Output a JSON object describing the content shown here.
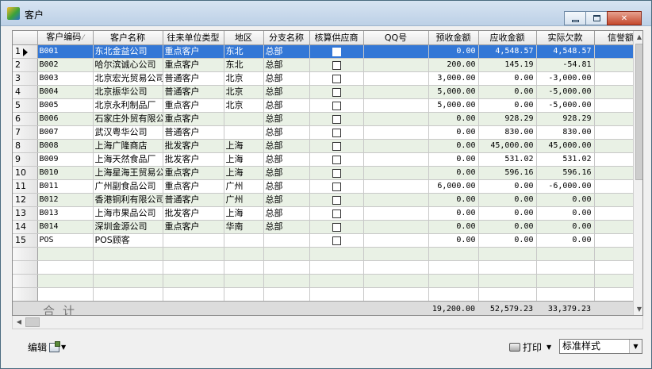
{
  "window": {
    "title": "客户"
  },
  "grid": {
    "columns": [
      {
        "key": "code",
        "label": "客户编码",
        "width": 70,
        "sort": "⁄"
      },
      {
        "key": "name",
        "label": "客户名称",
        "width": 88
      },
      {
        "key": "type",
        "label": "往来单位类型",
        "width": 77
      },
      {
        "key": "region",
        "label": "地区",
        "width": 50
      },
      {
        "key": "branch",
        "label": "分支名称",
        "width": 58
      },
      {
        "key": "supplier",
        "label": "核算供应商",
        "width": 68
      },
      {
        "key": "qq",
        "label": "QQ号",
        "width": 82
      },
      {
        "key": "prepaid",
        "label": "预收金额",
        "width": 63
      },
      {
        "key": "receivable",
        "label": "应收金额",
        "width": 73
      },
      {
        "key": "owed",
        "label": "实际欠款",
        "width": 73
      },
      {
        "key": "credit",
        "label": "信誉额度",
        "width": 78
      }
    ],
    "rows": [
      {
        "n": "1",
        "code": "B001",
        "name": "东北金益公司",
        "type": "重点客户",
        "region": "东北",
        "branch": "总部",
        "qq": "",
        "prepaid": "0.00",
        "receivable": "4,548.57",
        "owed": "4,548.57",
        "credit": "",
        "selected": true
      },
      {
        "n": "2",
        "code": "B002",
        "name": "哈尔滨诚心公司",
        "type": "重点客户",
        "region": "东北",
        "branch": "总部",
        "qq": "",
        "prepaid": "200.00",
        "receivable": "145.19",
        "owed": "-54.81",
        "credit": ""
      },
      {
        "n": "3",
        "code": "B003",
        "name": "北京宏光贸易公司",
        "type": "普通客户",
        "region": "北京",
        "branch": "总部",
        "qq": "",
        "prepaid": "3,000.00",
        "receivable": "0.00",
        "owed": "-3,000.00",
        "credit": ""
      },
      {
        "n": "4",
        "code": "B004",
        "name": "北京振华公司",
        "type": "普通客户",
        "region": "北京",
        "branch": "总部",
        "qq": "",
        "prepaid": "5,000.00",
        "receivable": "0.00",
        "owed": "-5,000.00",
        "credit": ""
      },
      {
        "n": "5",
        "code": "B005",
        "name": "北京永利制品厂",
        "type": "重点客户",
        "region": "北京",
        "branch": "总部",
        "qq": "",
        "prepaid": "5,000.00",
        "receivable": "0.00",
        "owed": "-5,000.00",
        "credit": ""
      },
      {
        "n": "6",
        "code": "B006",
        "name": "石家庄外贸有限公司",
        "type": "重点客户",
        "region": "",
        "branch": "总部",
        "qq": "",
        "prepaid": "0.00",
        "receivable": "928.29",
        "owed": "928.29",
        "credit": ""
      },
      {
        "n": "7",
        "code": "B007",
        "name": "武汉粤华公司",
        "type": "普通客户",
        "region": "",
        "branch": "总部",
        "qq": "",
        "prepaid": "0.00",
        "receivable": "830.00",
        "owed": "830.00",
        "credit": ""
      },
      {
        "n": "8",
        "code": "B008",
        "name": "上海广隆商店",
        "type": "批发客户",
        "region": "上海",
        "branch": "总部",
        "qq": "",
        "prepaid": "0.00",
        "receivable": "45,000.00",
        "owed": "45,000.00",
        "credit": ""
      },
      {
        "n": "9",
        "code": "B009",
        "name": "上海天然食品厂",
        "type": "批发客户",
        "region": "上海",
        "branch": "总部",
        "qq": "",
        "prepaid": "0.00",
        "receivable": "531.02",
        "owed": "531.02",
        "credit": ""
      },
      {
        "n": "10",
        "code": "B010",
        "name": "上海星海王贸易公司",
        "type": "重点客户",
        "region": "上海",
        "branch": "总部",
        "qq": "",
        "prepaid": "0.00",
        "receivable": "596.16",
        "owed": "596.16",
        "credit": ""
      },
      {
        "n": "11",
        "code": "B011",
        "name": "广州副食品公司",
        "type": "重点客户",
        "region": "广州",
        "branch": "总部",
        "qq": "",
        "prepaid": "6,000.00",
        "receivable": "0.00",
        "owed": "-6,000.00",
        "credit": ""
      },
      {
        "n": "12",
        "code": "B012",
        "name": "香港铜利有限公司",
        "type": "普通客户",
        "region": "广州",
        "branch": "总部",
        "qq": "",
        "prepaid": "0.00",
        "receivable": "0.00",
        "owed": "0.00",
        "credit": ""
      },
      {
        "n": "13",
        "code": "B013",
        "name": "上海市果品公司",
        "type": "批发客户",
        "region": "上海",
        "branch": "总部",
        "qq": "",
        "prepaid": "0.00",
        "receivable": "0.00",
        "owed": "0.00",
        "credit": ""
      },
      {
        "n": "14",
        "code": "B014",
        "name": "深圳金源公司",
        "type": "重点客户",
        "region": "华南",
        "branch": "总部",
        "qq": "",
        "prepaid": "0.00",
        "receivable": "0.00",
        "owed": "0.00",
        "credit": ""
      },
      {
        "n": "15",
        "code": "POS",
        "name": "POS顾客",
        "type": "",
        "region": "",
        "branch": "",
        "qq": "",
        "prepaid": "0.00",
        "receivable": "0.00",
        "owed": "0.00",
        "credit": ""
      }
    ],
    "empty_rows": 4,
    "totals": {
      "label": "合计",
      "prepaid": "19,200.00",
      "receivable": "52,579.23",
      "owed": "33,379.23"
    }
  },
  "footer": {
    "edit_label": "编辑",
    "print_label": "打印",
    "style_value": "标准样式"
  },
  "colors": {
    "selection": "#3377d6",
    "alt_row": "#e9f1e5"
  }
}
